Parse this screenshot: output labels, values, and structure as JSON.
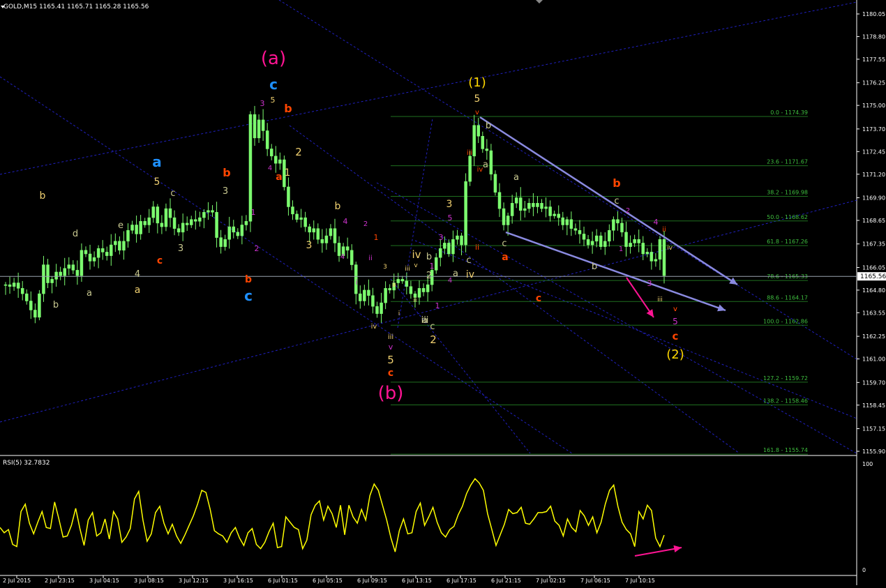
{
  "window": {
    "symbol_header": "GOLD,M15  1165.41 1165.71 1165.28 1165.56",
    "rsi_header": "RSI(5) 32.7832",
    "current_price": "1165.56"
  },
  "colors": {
    "background": "#000000",
    "candle": "#7CFC6F",
    "rsi_line": "#FFFF00",
    "grid_text": "#FFFFFF",
    "fib_line": "#1F6F1F",
    "fib_text": "#3FBF3F",
    "channel": "#2020C0",
    "trend_arrow": "#8A8AE0",
    "magenta": "#FF1493",
    "orange": "#FF4500",
    "yellow": "#FFD700",
    "cyan": "#1E90FF",
    "beige": "#F0D070",
    "olive": "#C8C890",
    "purple": "#CC33CC"
  },
  "chart_data": [
    {
      "type": "line",
      "title": "GOLD,M15",
      "ylim": [
        1155.9,
        1180.05
      ],
      "y_ticks": [
        "1180.05",
        "1178.80",
        "1177.55",
        "1176.25",
        "1175.00",
        "1173.70",
        "1172.45",
        "1171.20",
        "1169.90",
        "1168.65",
        "1167.35",
        "1166.05",
        "1164.80",
        "1163.55",
        "1162.25",
        "1161.00",
        "1159.70",
        "1158.45",
        "1157.15",
        "1155.90"
      ],
      "x_ticks": [
        "2 Jul 2015",
        "2 Jul 23:15",
        "3 Jul 04:15",
        "3 Jul 08:15",
        "3 Jul 12:15",
        "3 Jul 16:15",
        "6 Jul 01:15",
        "6 Jul 05:15",
        "6 Jul 09:15",
        "6 Jul 13:15",
        "6 Jul 17:15",
        "6 Jul 21:15",
        "7 Jul 02:15",
        "7 Jul 06:15",
        "7 Jul 10:15"
      ],
      "series": [
        {
          "values": [
            1165.1,
            1165.0,
            1165.2,
            1164.9,
            1164.6,
            1164.2,
            1163.7,
            1163.3,
            1164.6,
            1166.2,
            1165.2,
            1165.4,
            1165.8,
            1165.6,
            1166.0,
            1166.2,
            1165.9,
            1165.6,
            1167.0,
            1166.8,
            1166.4,
            1166.6,
            1167.1,
            1166.9,
            1166.7,
            1167.3,
            1167.5,
            1167.0,
            1167.5,
            1168.1,
            1168.4,
            1167.9,
            1168.6,
            1168.4,
            1168.8,
            1169.4,
            1168.5,
            1168.3,
            1169.3,
            1168.8,
            1168.2,
            1168.0,
            1168.5,
            1168.4,
            1168.7,
            1168.6,
            1168.8,
            1169.1,
            1169.2,
            1169.1,
            1167.7,
            1167.2,
            1167.6,
            1168.3,
            1168.0,
            1167.8,
            1168.4,
            1168.6,
            1174.5,
            1173.2,
            1174.2,
            1173.6,
            1172.6,
            1172.2,
            1171.8,
            1172.0,
            1170.5,
            1169.4,
            1169.0,
            1168.7,
            1168.8,
            1168.3,
            1168.0,
            1168.2,
            1167.6,
            1167.4,
            1167.8,
            1168.2,
            1167.4,
            1166.7,
            1167.2,
            1167.0,
            1166.2,
            1164.6,
            1164.2,
            1164.8,
            1164.5,
            1163.9,
            1163.5,
            1164.1,
            1164.9,
            1164.8,
            1165.2,
            1165.4,
            1165.3,
            1165.0,
            1164.6,
            1164.4,
            1164.9,
            1164.7,
            1165.1,
            1165.9,
            1166.6,
            1167.1,
            1167.4,
            1166.8,
            1167.6,
            1167.8,
            1167.3,
            1170.8,
            1172.2,
            1173.9,
            1173.3,
            1172.6,
            1172.5,
            1171.2,
            1170.2,
            1169.3,
            1168.4,
            1168.9,
            1169.6,
            1169.9,
            1169.2,
            1169.3,
            1169.6,
            1169.4,
            1169.6,
            1169.3,
            1169.4,
            1168.9,
            1169.0,
            1168.8,
            1168.4,
            1168.7,
            1168.2,
            1168.1,
            1167.9,
            1167.6,
            1167.3,
            1167.5,
            1167.8,
            1167.2,
            1167.5,
            1168.1,
            1168.7,
            1168.5,
            1168.0,
            1167.2,
            1167.4,
            1167.6,
            1167.4,
            1166.8,
            1166.9,
            1166.4,
            1166.5,
            1167.6,
            1165.6
          ]
        }
      ],
      "fibonacci_levels": [
        {
          "label": "0.0 - 1174.39",
          "price": 1174.39
        },
        {
          "label": "23.6 - 1171.67",
          "price": 1171.67
        },
        {
          "label": "38.2 - 1169.98",
          "price": 1169.98
        },
        {
          "label": "50.0 - 1168.62",
          "price": 1168.62
        },
        {
          "label": "61.8 - 1167.26",
          "price": 1167.26
        },
        {
          "label": "78.6 - 1165.33",
          "price": 1165.33
        },
        {
          "label": "88.6 - 1164.17",
          "price": 1164.17
        },
        {
          "label": "100.0 - 1162.86",
          "price": 1162.86
        },
        {
          "label": "127.2 - 1159.72",
          "price": 1159.72
        },
        {
          "label": "138.2 - 1158.46",
          "price": 1158.46
        },
        {
          "label": "161.8 - 1155.74",
          "price": 1155.74
        }
      ],
      "wave_labels": [
        "(a)",
        "c",
        "3",
        "5",
        "b",
        "4",
        "a",
        "2",
        "1",
        "a",
        "5",
        "c",
        "b",
        "3",
        "b",
        "d",
        "e",
        "4",
        "a",
        "c",
        "a",
        "3",
        "1",
        "2",
        "b",
        "c",
        "b",
        "b",
        "4",
        "3",
        "2",
        "4",
        "1",
        "ii",
        "i",
        "3",
        "iv",
        "iii",
        "v",
        "5",
        "c",
        "(b)",
        "3",
        "5",
        "3",
        "v",
        "iii",
        "iv",
        "ii",
        "i",
        "a",
        "a",
        "c",
        "2",
        "b",
        "4",
        "1",
        "iv",
        "c",
        "iii",
        "2",
        "1",
        "ii",
        "(1)",
        "5",
        "v",
        "b",
        "iii",
        "iv",
        "a",
        "a",
        "c",
        "a",
        "c",
        "b",
        "b",
        "c",
        "2",
        "1",
        "4",
        "ii",
        "iv",
        "3",
        "iii",
        "v",
        "5",
        "c",
        "(2)",
        "i",
        "v",
        "a"
      ]
    },
    {
      "type": "line",
      "title": "RSI(5) 32.7832",
      "ylim": [
        0,
        100
      ],
      "y_ticks": [
        "100",
        "0"
      ],
      "series": [
        {
          "name": "RSI(5)",
          "values": [
            40,
            35,
            38,
            24,
            22,
            55,
            62,
            44,
            34,
            45,
            55,
            40,
            39,
            64,
            48,
            31,
            32,
            42,
            58,
            39,
            23,
            47,
            54,
            32,
            35,
            48,
            29,
            55,
            48,
            26,
            31,
            39,
            67,
            74,
            47,
            27,
            34,
            54,
            60,
            44,
            34,
            43,
            32,
            25,
            33,
            42,
            51,
            62,
            75,
            73,
            57,
            37,
            34,
            32,
            26,
            35,
            40,
            30,
            23,
            35,
            39,
            24,
            20,
            26,
            36,
            44,
            21,
            22,
            50,
            45,
            40,
            38,
            20,
            28,
            52,
            61,
            65,
            47,
            60,
            53,
            40,
            61,
            33,
            61,
            50,
            44,
            57,
            47,
            70,
            81,
            75,
            61,
            47,
            30,
            17,
            37,
            48,
            34,
            35,
            55,
            63,
            42,
            50,
            59,
            45,
            35,
            31,
            38,
            41,
            52,
            60,
            72,
            80,
            86,
            82,
            75,
            53,
            38,
            23,
            33,
            43,
            57,
            53,
            54,
            59,
            44,
            43,
            48,
            54,
            54,
            55,
            60,
            46,
            42,
            32,
            48,
            40,
            36,
            56,
            51,
            42,
            50,
            35,
            45,
            62,
            75,
            80,
            60,
            45,
            38,
            34,
            22,
            55,
            48,
            61,
            56,
            30,
            22,
            32.8
          ]
        }
      ]
    }
  ]
}
